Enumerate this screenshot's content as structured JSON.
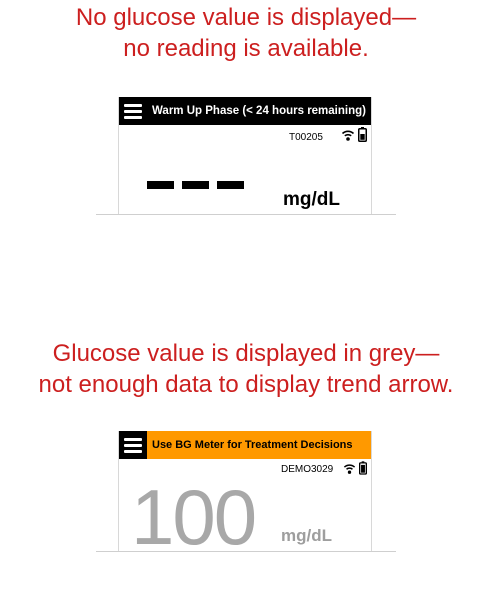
{
  "captions": {
    "top": [
      "No glucose value is displayed—",
      "no reading is available."
    ],
    "bottom": [
      "Glucose value is displayed in grey—",
      "not enough data to display trend arrow."
    ]
  },
  "screen1": {
    "header_title": "Warm Up Phase (< 24 hours remaining)",
    "device_id": "T00205",
    "unit": "mg/dL",
    "status_icons": [
      "signal-icon",
      "battery-icon"
    ]
  },
  "screen2": {
    "header_title": "Use BG Meter for Treatment Decisions",
    "device_id": "DEMO3029",
    "glucose_value": "100",
    "unit": "mg/dL",
    "status_icons": [
      "signal-icon",
      "battery-icon"
    ]
  },
  "colors": {
    "caption_red": "#cc1f1f",
    "header_dark": "#000000",
    "header_orange": "#ff9900",
    "grey_value": "#a8a8a8"
  }
}
